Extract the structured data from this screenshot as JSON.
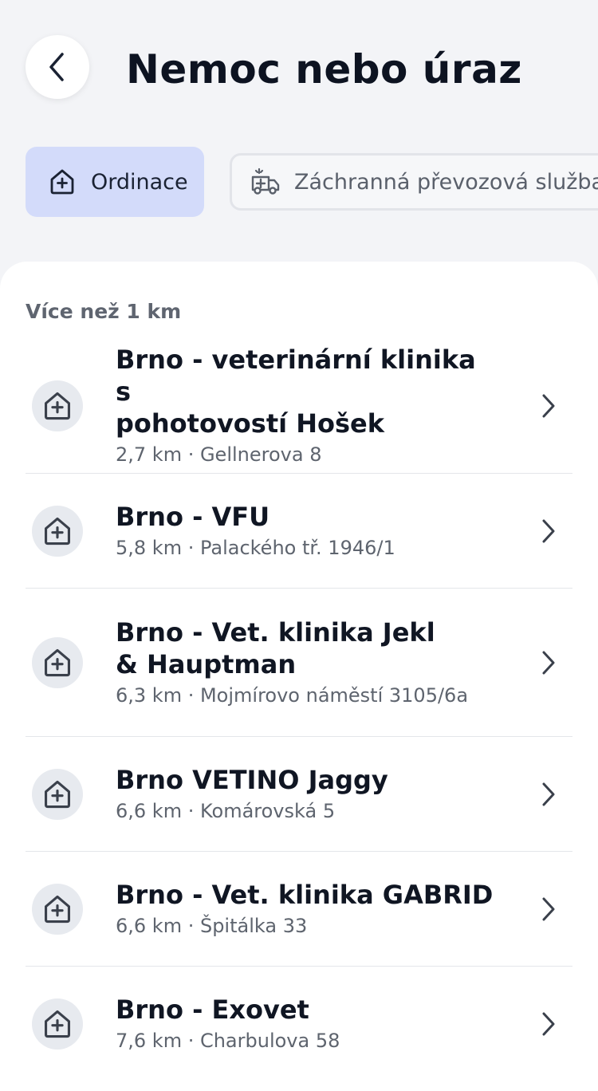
{
  "header": {
    "title": "Nemoc nebo úraz",
    "back_icon": "chevron-left-icon"
  },
  "tabs": [
    {
      "label": "Ordinace",
      "icon": "clinic-plus-icon",
      "active": true
    },
    {
      "label": "Záchranná převozová služba",
      "icon": "ambulance-icon",
      "active": false
    }
  ],
  "list": {
    "section_label": "Více než 1 km",
    "items": [
      {
        "name_line1": "Brno - veterinární klinika s",
        "name_line2": "pohotovostí Hošek",
        "meta": "2,7 km · Gellnerova 8"
      },
      {
        "name_line1": "Brno - VFU",
        "name_line2": "",
        "meta": "5,8 km · Palackého tř. 1946/1"
      },
      {
        "name_line1": "Brno - Vet. klinika Jekl",
        "name_line2": "& Hauptman",
        "meta": "6,3 km · Mojmírovo náměstí 3105/6a"
      },
      {
        "name_line1": "Brno VETINO Jaggy",
        "name_line2": "",
        "meta": "6,6 km · Komárovská 5"
      },
      {
        "name_line1": "Brno - Vet. klinika GABRID",
        "name_line2": "",
        "meta": "6,6 km · Špitálka 33"
      },
      {
        "name_line1": "Brno - Exovet",
        "name_line2": "",
        "meta": "7,6 km · Charbulova 58"
      }
    ]
  },
  "colors": {
    "background": "#f3f4f7",
    "active_tab": "#d3dbfa",
    "text_primary": "#0d1321",
    "text_secondary": "#5e646e",
    "icon_bg": "#e7eaef"
  }
}
